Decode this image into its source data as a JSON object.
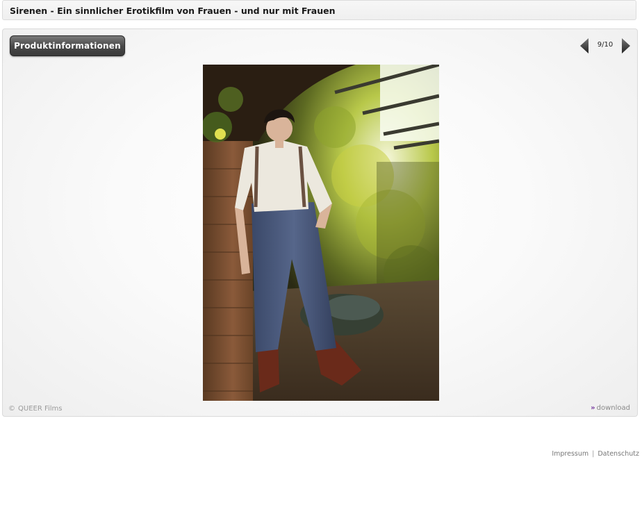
{
  "page": {
    "title": "Sirenen - Ein sinnlicher Erotikfilm von Frauen - und nur mit Frauen"
  },
  "gallery": {
    "info_button_label": "Produktinformationen",
    "counter": "9/10",
    "photo_alt": "",
    "credit_symbol": "©",
    "credit": "QUEER Films",
    "download_label": "download",
    "download_icon": "double-chevron-down-icon",
    "prev_icon": "arrow-left-icon",
    "next_icon": "arrow-right-icon"
  },
  "footer": {
    "impressum": "Impressum",
    "separator": "|",
    "datenschutz": "Datenschutz"
  },
  "colors": {
    "button_bg": "#4a4a4a",
    "download_icon": "#7a3fa0",
    "text_muted": "#9a9a9a"
  }
}
